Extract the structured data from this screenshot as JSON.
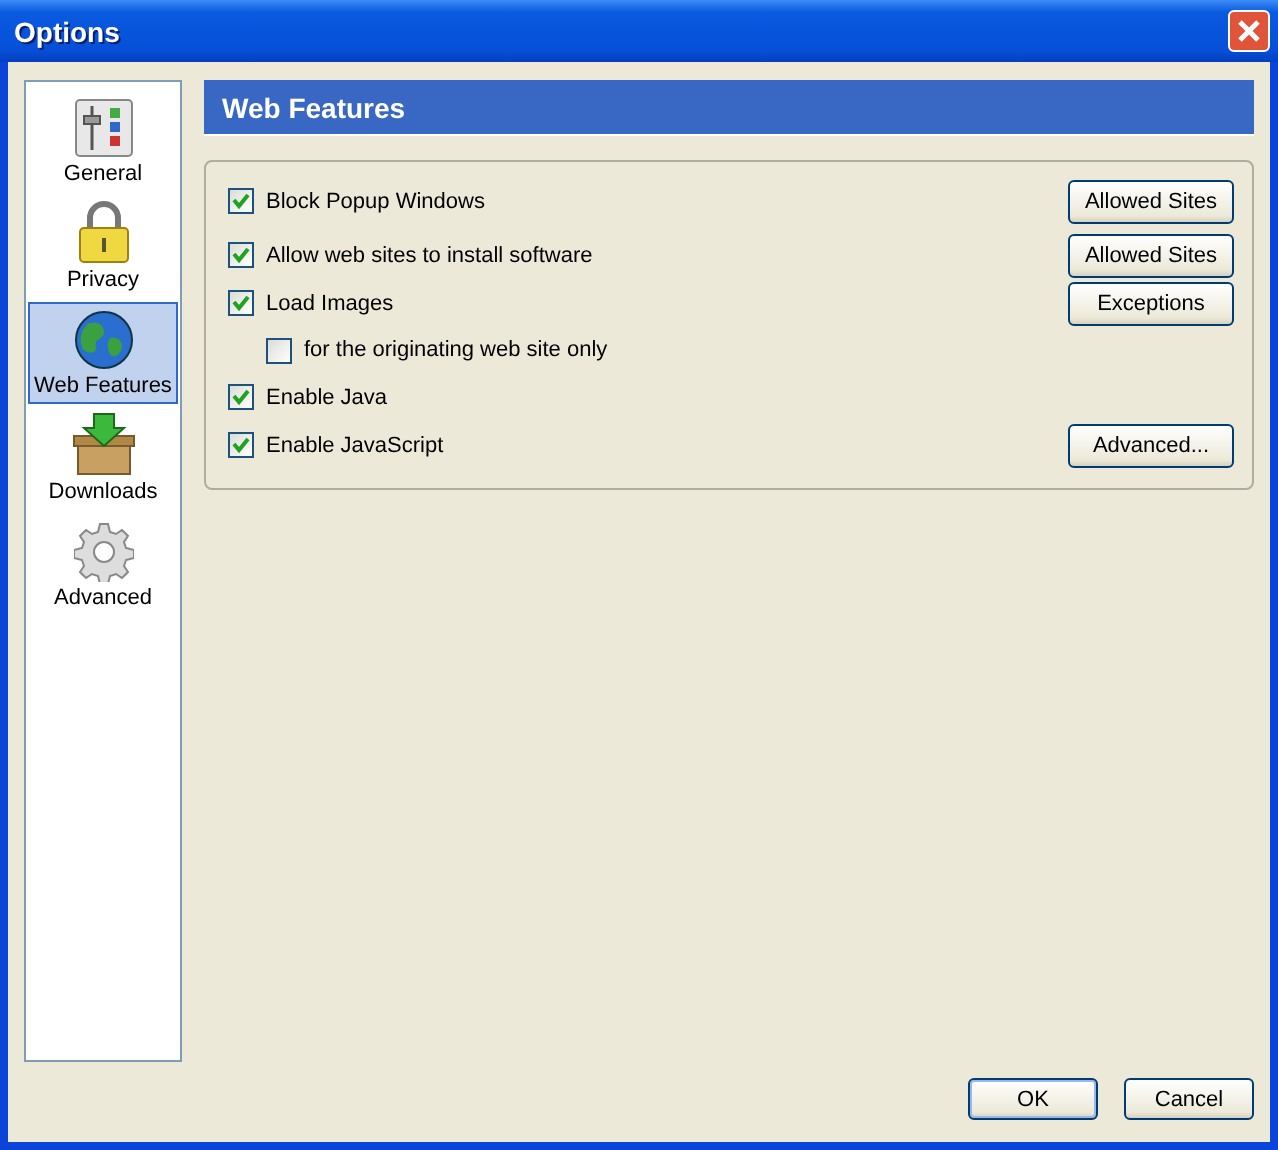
{
  "window": {
    "title": "Options"
  },
  "sidebar": {
    "items": [
      {
        "label": "General",
        "kind": "general",
        "selected": false
      },
      {
        "label": "Privacy",
        "kind": "privacy",
        "selected": false
      },
      {
        "label": "Web Features",
        "kind": "web",
        "selected": true
      },
      {
        "label": "Downloads",
        "kind": "downloads",
        "selected": false
      },
      {
        "label": "Advanced",
        "kind": "advanced",
        "selected": false
      }
    ]
  },
  "panel": {
    "title": "Web Features",
    "options": [
      {
        "label": "Block Popup Windows",
        "checked": true,
        "button": "Allowed Sites"
      },
      {
        "label": "Allow web sites to install software",
        "checked": true,
        "button": "Allowed Sites"
      },
      {
        "label": "Load Images",
        "checked": true,
        "button": "Exceptions",
        "children": [
          {
            "label": "for the originating web site only",
            "checked": false
          }
        ]
      },
      {
        "label": "Enable Java",
        "checked": true
      },
      {
        "label": "Enable JavaScript",
        "checked": true,
        "button": "Advanced..."
      }
    ]
  },
  "buttons": [
    "OK",
    "Cancel"
  ]
}
